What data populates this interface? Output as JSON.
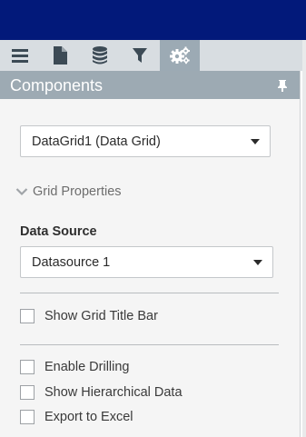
{
  "tabs": [
    {
      "icon": "menu-icon"
    },
    {
      "icon": "document-icon"
    },
    {
      "icon": "database-icon"
    },
    {
      "icon": "filter-icon"
    },
    {
      "icon": "gears-icon",
      "active": true
    }
  ],
  "panel": {
    "title": "Components",
    "pin_icon": "pin-icon"
  },
  "component_select": {
    "value": "DataGrid1 (Data Grid)"
  },
  "grid_properties": {
    "label": "Grid Properties",
    "expanded": true
  },
  "data_source": {
    "label": "Data Source",
    "value": "Datasource 1"
  },
  "options": [
    {
      "label": "Show Grid Title Bar",
      "checked": false
    },
    {
      "label": "Enable Drilling",
      "checked": false
    },
    {
      "label": "Show Hierarchical Data",
      "checked": false
    },
    {
      "label": "Export to Excel",
      "checked": false
    }
  ],
  "colors": {
    "topbar": "#02197a",
    "panel_header": "#9daab3",
    "active_tab": "#9caab4"
  }
}
